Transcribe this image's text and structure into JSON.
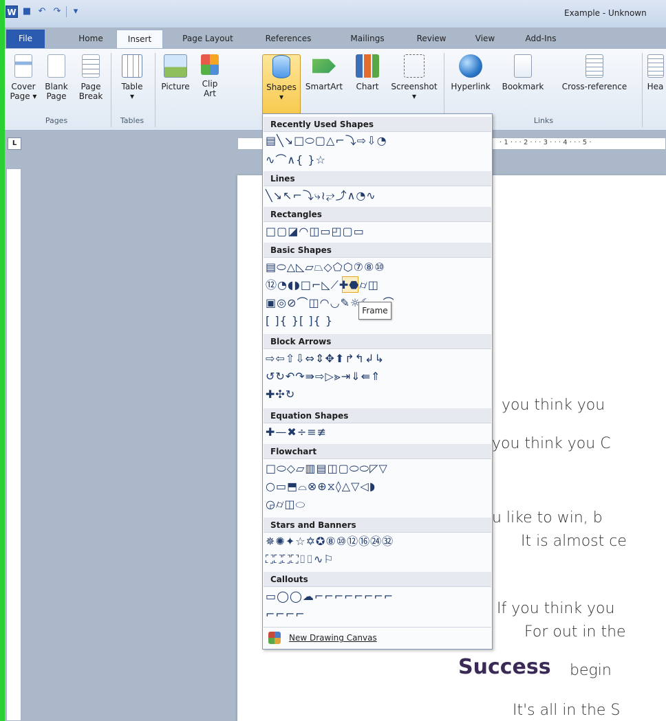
{
  "window": {
    "title": "Example - Unknown"
  },
  "qat": {
    "word": "W",
    "save": "■",
    "undo": "↶",
    "redo": "↷",
    "more": "▾"
  },
  "tabs": [
    {
      "label": "File"
    },
    {
      "label": "Home"
    },
    {
      "label": "Insert"
    },
    {
      "label": "Page Layout"
    },
    {
      "label": "References"
    },
    {
      "label": "Mailings"
    },
    {
      "label": "Review"
    },
    {
      "label": "View"
    },
    {
      "label": "Add-Ins"
    }
  ],
  "ribbon": {
    "cover_page": "Cover",
    "cover_page2": "Page ▾",
    "blank_page": "Blank",
    "blank_page2": "Page",
    "page_break": "Page",
    "page_break2": "Break",
    "table": "Table",
    "table_arrow": "▾",
    "picture": "Picture",
    "clip_art": "Clip",
    "clip_art2": "Art",
    "shapes": "Shapes",
    "shapes_arrow": "▾",
    "smartart": "SmartArt",
    "chart": "Chart",
    "screenshot": "Screenshot",
    "screenshot_arrow": "▾",
    "hyperlink": "Hyperlink",
    "bookmark": "Bookmark",
    "cross_reference": "Cross-reference",
    "header": "Hea",
    "groups": {
      "pages": "Pages",
      "tables": "Tables",
      "links": "Links"
    }
  },
  "ruler": {
    "corner": "L",
    "marks": "· 1 · · · 2 · · · 3 · · · 4 · · · 5 ·"
  },
  "shapes_menu": {
    "recently_used": "Recently Used Shapes",
    "recent_row1": "▤╲↘□⬭▢△⌐⤵⇨⇩◔",
    "recent_row2": "∿⌒∧{ }☆",
    "lines": "Lines",
    "lines_row": "╲↘↖⌐⤵⤷≀⥂⤴∧◔∿",
    "rectangles": "Rectangles",
    "rect_row": "□▢◪◠◫▭◰▢▭",
    "basic_shapes": "Basic Shapes",
    "basic_row1": "▤⬭△◺▱⏢◇⬠⬡⑦⑧⑩",
    "basic_row2": "⑫◔◖◗□⌐◺⟋✚⬣⌭◫",
    "basic_row3": "▣◎⊘⌒◫◠◡✎☼☾☁⌒",
    "basic_row4": "[ ]{ }[ ]{ }",
    "block_arrows": "Block Arrows",
    "block_row1": "⇨⇦⇧⇩⇔⇕✥⬆↱↰↲↳",
    "block_row2": "↺↻↶↷⇛⇨▷⪢⇥⇓⇚⇑",
    "block_row3": "✚✣↻",
    "equation_shapes": "Equation Shapes",
    "equation_row": "✚—✖÷≡≢",
    "flowchart": "Flowchart",
    "flow_row1": "□⬭◇▱▥▤◫▢⬭⬭◸▽",
    "flow_row2": "○▭⬒⌓⊗⊕⧖◊△▽◁◗",
    "flow_row3": "◶⌭◫⬭",
    "stars_banners": "Stars and Banners",
    "stars_row1": "✵✺✦☆✡✪⑧⑩⑫⑯㉔㉜",
    "stars_row2": "⛶⛶⛶⛶⌷⌷∿⚐",
    "callouts": "Callouts",
    "callouts_row1": "▭◯◯☁⌐⌐⌐⌐⌐⌐⌐⌐",
    "callouts_row2": "⌐⌐⌐⌐",
    "tooltip": "Frame",
    "new_canvas": "New Drawing Canvas"
  },
  "document": {
    "line1": "you think you",
    "line2": "you think you C",
    "line3": "u like to win, b",
    "line4": "It is almost ce",
    "line5": "If you think you",
    "line6": "For out in the",
    "line7a": "Success",
    "line7b": " begin",
    "line8": "It's all in the S"
  }
}
